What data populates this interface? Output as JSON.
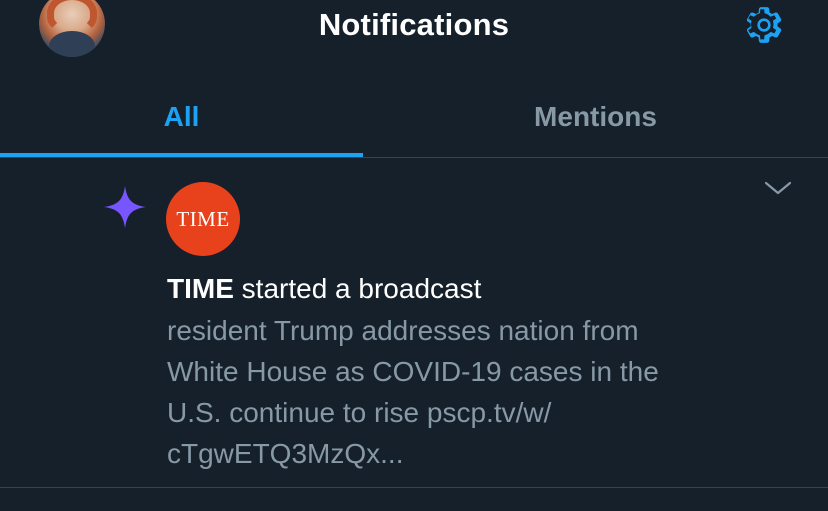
{
  "header": {
    "title": "Notifications",
    "avatar_icon": "user-avatar",
    "settings_icon": "gear-icon"
  },
  "tabs": [
    {
      "label": "All",
      "selected": true
    },
    {
      "label": "Mentions",
      "selected": false
    }
  ],
  "colors": {
    "background": "#15202b",
    "accent": "#1da1f2",
    "muted": "#8899a6",
    "divider": "#38444d",
    "sparkle": "#7856ff",
    "time_brand": "#e8421d"
  },
  "notification": {
    "type_icon": "sparkle-icon",
    "avatar_text": "TIME",
    "actor": "TIME",
    "action": " started a broadcast",
    "body_lines": [
      "resident Trump addresses nation from",
      "White House as COVID-19 cases in the",
      "U.S. continue to rise pscp.tv/w/",
      "cTgwETQ3MzQx..."
    ],
    "menu_icon": "chevron-down-icon"
  }
}
